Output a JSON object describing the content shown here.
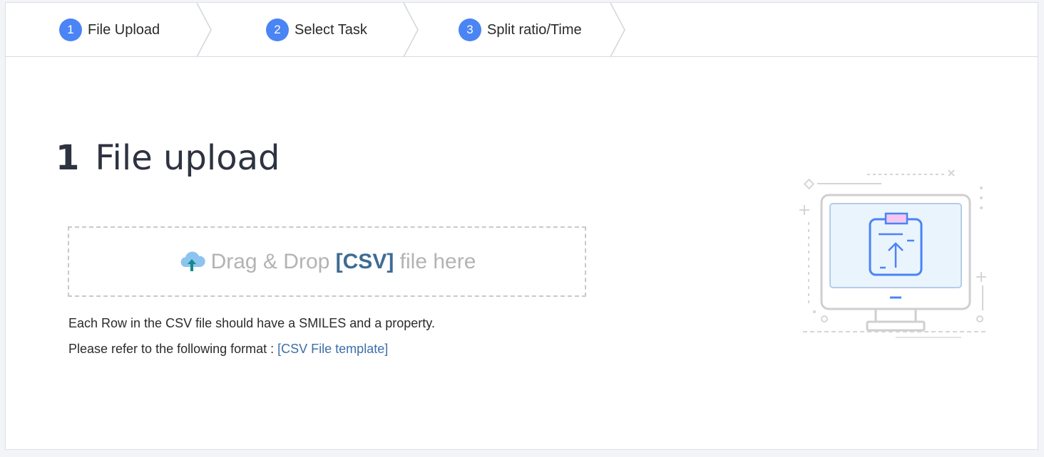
{
  "steps": [
    {
      "num": "1",
      "label": "File Upload"
    },
    {
      "num": "2",
      "label": "Select Task"
    },
    {
      "num": "3",
      "label": "Split ratio/Time"
    }
  ],
  "section": {
    "number": "1",
    "title": "File upload"
  },
  "dropzone": {
    "prefix": "Drag & Drop",
    "format": "[CSV]",
    "suffix": "file here",
    "icon": "cloud-upload-icon"
  },
  "notes": {
    "line1": "Each Row in the CSV file should have a SMILES and a property.",
    "line2_prefix": "Please refer to the following format :",
    "template_link": "[CSV File template]"
  },
  "illustration": {
    "icon": "monitor-clipboard-upload-icon"
  },
  "colors": {
    "accent": "#4a84f5",
    "link": "#3d6fa8",
    "csv_highlight": "#3e6c94"
  }
}
